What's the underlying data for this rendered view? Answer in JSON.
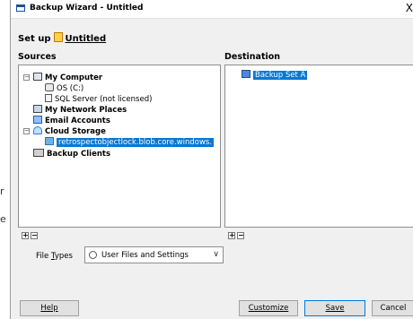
{
  "window": {
    "title": "Backup Wizard - Untitled",
    "close_glyph": "X"
  },
  "setup": {
    "prefix": "Set up",
    "name": "Untitled"
  },
  "sources": {
    "heading": "Sources",
    "items": [
      {
        "label": "My Computer",
        "icon": "computer-icon",
        "bold": true
      },
      {
        "label": "OS (C:)",
        "icon": "disk-icon",
        "bold": false
      },
      {
        "label": "SQL Server (not licensed)",
        "icon": "server-icon",
        "bold": false
      },
      {
        "label": "My Network Places",
        "icon": "network-icon",
        "bold": true
      },
      {
        "label": "Email Accounts",
        "icon": "email-icon",
        "bold": true
      },
      {
        "label": "Cloud Storage",
        "icon": "cloud-icon",
        "bold": true
      },
      {
        "label": "retrospectobjectlock.blob.core.windows.",
        "icon": "bucket-icon",
        "bold": false,
        "selected": true
      },
      {
        "label": "Backup Clients",
        "icon": "clients-icon",
        "bold": true
      }
    ]
  },
  "destination": {
    "heading": "Destination",
    "items": [
      {
        "label": "Backup Set A",
        "icon": "backup-set-icon",
        "selected": true
      }
    ]
  },
  "file_types": {
    "label_pre": "File ",
    "label_u": "T",
    "label_post": "ypes",
    "selected": "User Files and Settings"
  },
  "buttons": {
    "help": "Help",
    "customize": "Customize",
    "save": "Save",
    "cancel": "Cancel"
  },
  "side_fragments": {
    "a": "r",
    "b": "e"
  },
  "colors": {
    "selection": "#0078d7",
    "window_bg": "#f0f0f0"
  }
}
